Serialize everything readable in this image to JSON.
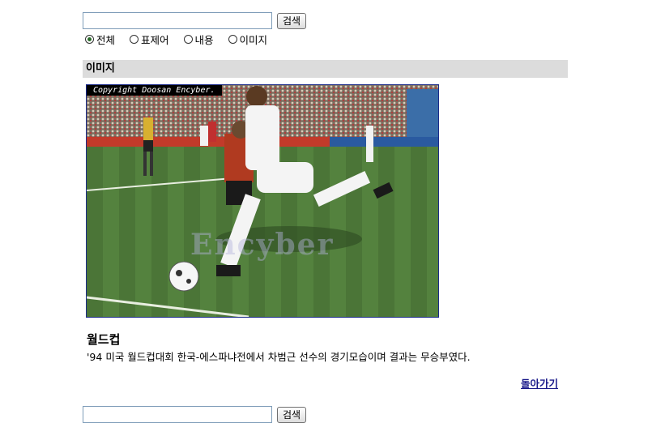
{
  "search": {
    "value": "",
    "button_label": "검색"
  },
  "search_options": [
    {
      "label": "전체",
      "checked": true
    },
    {
      "label": "표제어",
      "checked": false
    },
    {
      "label": "내용",
      "checked": false
    },
    {
      "label": "이미지",
      "checked": false
    }
  ],
  "section": {
    "title": "이미지"
  },
  "image": {
    "copyright": "Copyright Doosan Encyber.",
    "watermark": "Encyber",
    "depicts": "soccer-player-kicking-ball"
  },
  "entry": {
    "title": "월드컵",
    "caption": "'94 미국 월드컵대회 한국-에스파냐전에서 차범근 선수의 경기모습이며 결과는 무승부였다."
  },
  "back_link": "돌아가기",
  "bottom_search": {
    "button_label": "검색"
  }
}
